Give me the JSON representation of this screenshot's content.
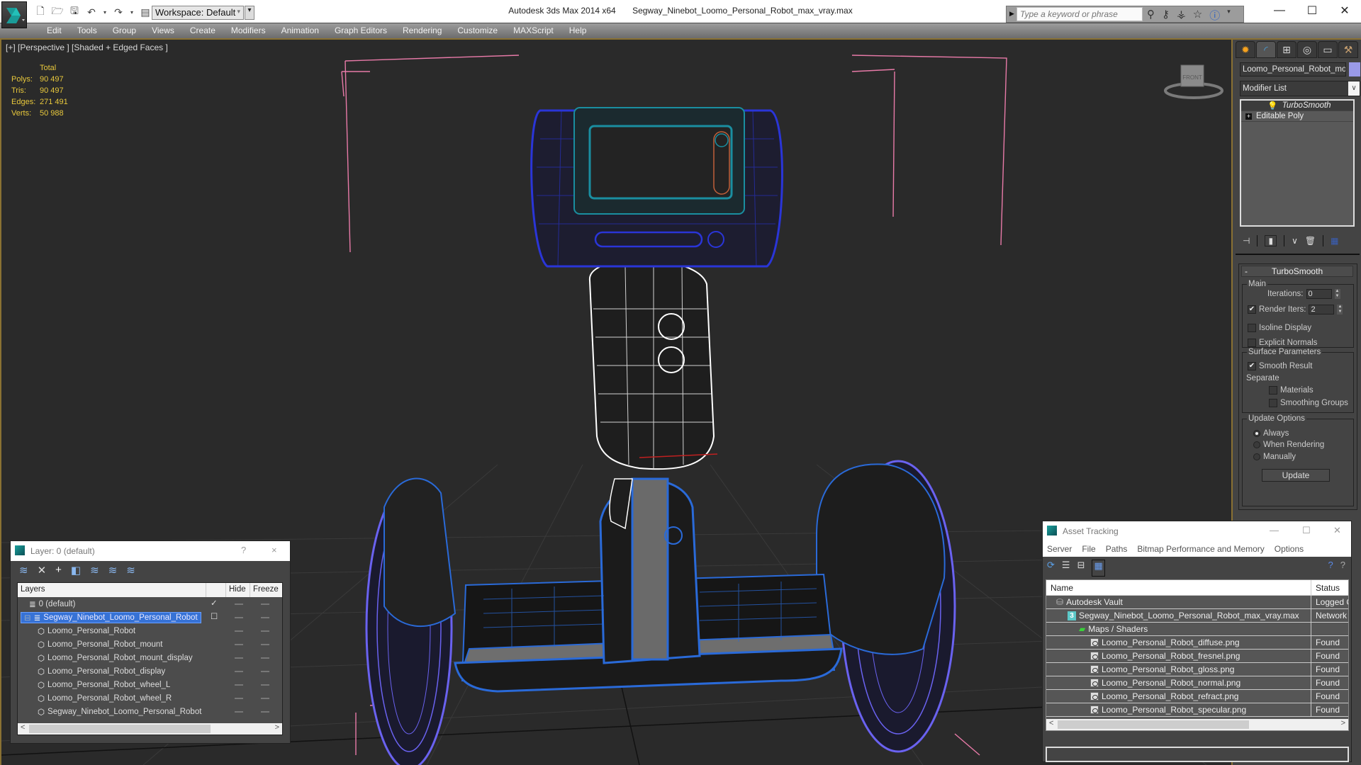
{
  "titlebar": {
    "app_title": "Autodesk 3ds Max  2014 x64",
    "file_title": "Segway_Ninebot_Loomo_Personal_Robot_max_vray.max",
    "workspace": "Workspace: Default",
    "search_placeholder": "Type a keyword or phrase",
    "quick_access_icons": [
      "new-file-icon",
      "open-file-icon",
      "save-icon",
      "undo-icon",
      "redo-icon",
      "project-folder-icon"
    ],
    "search_icons": [
      "binoculars-icon",
      "key-icon",
      "satellite-icon",
      "star-icon",
      "help-icon"
    ],
    "window_controls": [
      "minimize",
      "maximize",
      "close"
    ]
  },
  "menubar": {
    "items": [
      "Edit",
      "Tools",
      "Group",
      "Views",
      "Create",
      "Modifiers",
      "Animation",
      "Graph Editors",
      "Rendering",
      "Customize",
      "MAXScript",
      "Help"
    ]
  },
  "viewport": {
    "label": "[+] [Perspective ] [Shaded + Edged Faces ]",
    "stats": {
      "header": "Total",
      "rows": [
        {
          "key": "Polys:",
          "value": "90 497"
        },
        {
          "key": "Tris:",
          "value": "90 497"
        },
        {
          "key": "Edges:",
          "value": "271 491"
        },
        {
          "key": "Verts:",
          "value": "50 988"
        }
      ]
    },
    "viewcube_face": "FRONT",
    "colors": {
      "stats_text": "#e8c83c",
      "wire_blue": "#2a35d8",
      "wire_cyan": "#1a8ea0",
      "wire_white": "#ffffff",
      "wire_lightblue": "#2a6ad8",
      "wire_violet": "#6a62f0",
      "bbox_pink": "#e87aa8"
    }
  },
  "command_panel": {
    "tabs": [
      "create-tab",
      "modify-tab",
      "hierarchy-tab",
      "motion-tab",
      "display-tab",
      "utilities-tab"
    ],
    "object_name": "Loomo_Personal_Robot_mount",
    "object_color": "#9a9ae8",
    "modifier_list": "Modifier List",
    "stack": [
      {
        "label": "TurboSmooth",
        "selected": true
      },
      {
        "label": "Editable Poly",
        "selected": false
      }
    ],
    "turbosmooth": {
      "title": "TurboSmooth",
      "main_label": "Main",
      "iterations_label": "Iterations:",
      "iterations_value": "0",
      "render_iters_label": "Render Iters:",
      "render_iters_value": "2",
      "render_iters_checked": true,
      "isoline_label": "Isoline Display",
      "isoline_checked": false,
      "explicit_normals_label": "Explicit Normals",
      "explicit_normals_checked": false,
      "surface_label": "Surface Parameters",
      "smooth_result_label": "Smooth Result",
      "smooth_result_checked": true,
      "separate_label": "Separate",
      "materials_label": "Materials",
      "materials_checked": false,
      "smoothing_groups_label": "Smoothing Groups",
      "smoothing_groups_checked": false,
      "update_options_label": "Update Options",
      "update_options": [
        {
          "label": "Always",
          "selected": true
        },
        {
          "label": "When Rendering",
          "selected": false
        },
        {
          "label": "Manually",
          "selected": false
        }
      ],
      "update_button": "Update"
    }
  },
  "layer_panel": {
    "title": "Layer: 0 (default)",
    "help": "?",
    "close": "×",
    "toolbar_icons": [
      "create-layer-icon",
      "delete-layer-icon",
      "add-to-layer-icon",
      "select-objects-icon",
      "select-layer-icon",
      "highlight-layer-icon",
      "layer-settings-icon"
    ],
    "columns": [
      "Layers",
      "",
      "Hide",
      "Freeze"
    ],
    "rows": [
      {
        "name": "0 (default)",
        "type": "layer",
        "indent": 1,
        "active": true,
        "selected": false
      },
      {
        "name": "Segway_Ninebot_Loomo_Personal_Robot",
        "type": "layer",
        "indent": 0,
        "active": false,
        "selected": true
      },
      {
        "name": "Loomo_Personal_Robot",
        "type": "object",
        "indent": 2
      },
      {
        "name": "Loomo_Personal_Robot_mount",
        "type": "object",
        "indent": 2
      },
      {
        "name": "Loomo_Personal_Robot_mount_display",
        "type": "object",
        "indent": 2
      },
      {
        "name": "Loomo_Personal_Robot_display",
        "type": "object",
        "indent": 2
      },
      {
        "name": "Loomo_Personal_Robot_wheel_L",
        "type": "object",
        "indent": 2
      },
      {
        "name": "Loomo_Personal_Robot_wheel_R",
        "type": "object",
        "indent": 2
      },
      {
        "name": "Segway_Ninebot_Loomo_Personal_Robot",
        "type": "object",
        "indent": 2
      }
    ]
  },
  "asset_panel": {
    "title": "Asset Tracking",
    "menu": [
      "Server",
      "File",
      "Paths",
      "Bitmap Performance and Memory",
      "Options"
    ],
    "toolbar_icons": [
      "refresh-icon",
      "list-icon",
      "tree-icon",
      "table-icon"
    ],
    "columns": [
      "Name",
      "Status"
    ],
    "rows": [
      {
        "name": "Autodesk Vault",
        "status": "Logged Out",
        "indent": 1,
        "icon": "vault-icon"
      },
      {
        "name": "Segway_Ninebot_Loomo_Personal_Robot_max_vray.max",
        "status": "Network Path",
        "indent": 2,
        "icon": "max-file-icon"
      },
      {
        "name": "Maps / Shaders",
        "status": "",
        "indent": 3,
        "icon": "maps-icon"
      },
      {
        "name": "Loomo_Personal_Robot_diffuse.png",
        "status": "Found",
        "indent": 4,
        "icon": "png-file-icon"
      },
      {
        "name": "Loomo_Personal_Robot_fresnel.png",
        "status": "Found",
        "indent": 4,
        "icon": "png-file-icon"
      },
      {
        "name": "Loomo_Personal_Robot_gloss.png",
        "status": "Found",
        "indent": 4,
        "icon": "png-file-icon"
      },
      {
        "name": "Loomo_Personal_Robot_normal.png",
        "status": "Found",
        "indent": 4,
        "icon": "png-file-icon"
      },
      {
        "name": "Loomo_Personal_Robot_refract.png",
        "status": "Found",
        "indent": 4,
        "icon": "png-file-icon"
      },
      {
        "name": "Loomo_Personal_Robot_specular.png",
        "status": "Found",
        "indent": 4,
        "icon": "png-file-icon"
      }
    ]
  }
}
